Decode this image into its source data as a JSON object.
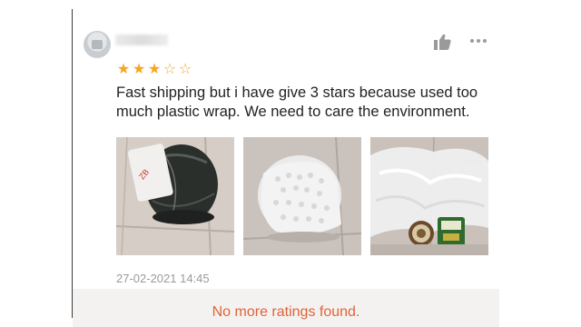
{
  "review": {
    "rating": 3,
    "rating_max": 5,
    "star_filled": "★",
    "star_empty": "☆",
    "text": "Fast shipping but i have give 3 stars because used too much plastic wrap. We need to care the environment.",
    "timestamp": "27-02-2021 14:45",
    "photos": [
      {
        "icon": "black-wrapped-parcel"
      },
      {
        "icon": "bubble-wrapped-parcel"
      },
      {
        "icon": "unwrapped-plastic-with-product"
      }
    ]
  },
  "footer": {
    "message": "No more ratings found."
  },
  "colors": {
    "star": "#f5a623",
    "footer_text": "#e0633a",
    "footer_bg": "#f4f2f0",
    "timestamp": "#9a9a9a"
  }
}
